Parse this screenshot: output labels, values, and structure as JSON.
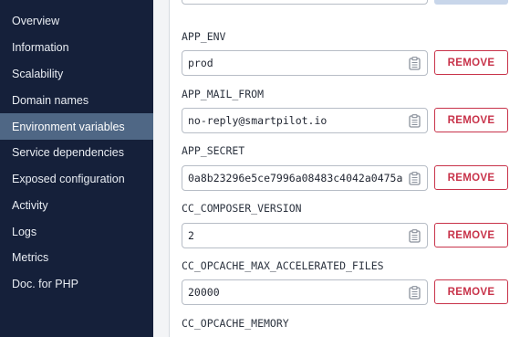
{
  "sidebar": {
    "items": [
      {
        "label": "Overview"
      },
      {
        "label": "Information"
      },
      {
        "label": "Scalability"
      },
      {
        "label": "Domain names"
      },
      {
        "label": "Environment variables",
        "active": true
      },
      {
        "label": "Service dependencies"
      },
      {
        "label": "Exposed configuration"
      },
      {
        "label": "Activity"
      },
      {
        "label": "Logs"
      },
      {
        "label": "Metrics"
      },
      {
        "label": "Doc. for PHP"
      }
    ]
  },
  "env_vars": [
    {
      "name": "APP_ENV",
      "value": "prod"
    },
    {
      "name": "APP_MAIL_FROM",
      "value": "no-reply@smartpilot.io"
    },
    {
      "name": "APP_SECRET",
      "value": "0a8b23296e5ce7996a08483c4042a0475a"
    },
    {
      "name": "CC_COMPOSER_VERSION",
      "value": "2"
    },
    {
      "name": "CC_OPCACHE_MAX_ACCELERATED_FILES",
      "value": "20000"
    },
    {
      "name": "CC_OPCACHE_MEMORY"
    }
  ],
  "actions": {
    "remove_label": "REMOVE"
  },
  "icons": {
    "copy": "clipboard-icon"
  },
  "colors": {
    "sidebar_bg": "#15203a",
    "sidebar_active_bg": "#4f6785",
    "remove_accent": "#c8334a"
  }
}
